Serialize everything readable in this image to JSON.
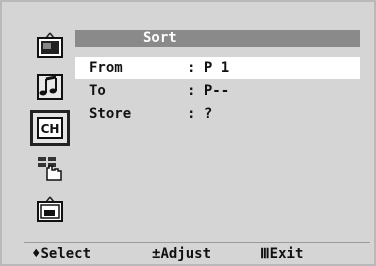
{
  "menu": {
    "title": "Sort",
    "rows": [
      {
        "label": "From",
        "value": ": P 1"
      },
      {
        "label": "To",
        "value": ": P--"
      },
      {
        "label": "Store",
        "value": ": ?"
      }
    ]
  },
  "sidebar": {
    "icons": [
      {
        "name": "picture-icon"
      },
      {
        "name": "sound-icon"
      },
      {
        "name": "channel-icon",
        "label": "CH"
      },
      {
        "name": "function-icon"
      },
      {
        "name": "pip-icon"
      }
    ]
  },
  "footer": {
    "select_glyph": "♦",
    "select_label": "Select",
    "adjust_glyph": "±",
    "adjust_label": "Adjust",
    "exit_glyph": "Ⅲ",
    "exit_label": "Exit"
  }
}
